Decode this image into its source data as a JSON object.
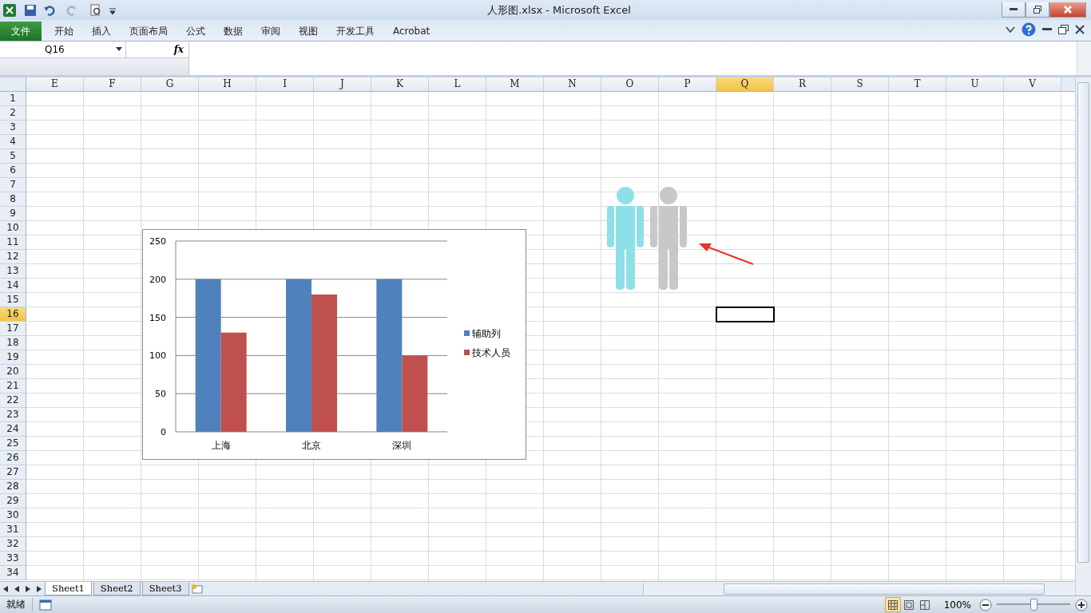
{
  "window": {
    "title": "人形图.xlsx - Microsoft Excel"
  },
  "ribbon_tabs": [
    {
      "label": "文件",
      "kind": "file"
    },
    {
      "label": "开始",
      "kind": "tab"
    },
    {
      "label": "插入",
      "kind": "tab"
    },
    {
      "label": "页面布局",
      "kind": "tab"
    },
    {
      "label": "公式",
      "kind": "tab"
    },
    {
      "label": "数据",
      "kind": "tab"
    },
    {
      "label": "审阅",
      "kind": "tab"
    },
    {
      "label": "视图",
      "kind": "tab"
    },
    {
      "label": "开发工具",
      "kind": "tab"
    },
    {
      "label": "Acrobat",
      "kind": "tab"
    }
  ],
  "formula_bar": {
    "name_box": "Q16",
    "fx": "fx"
  },
  "columns": [
    {
      "label": "E",
      "selected": false
    },
    {
      "label": "F",
      "selected": false
    },
    {
      "label": "G",
      "selected": false
    },
    {
      "label": "H",
      "selected": false
    },
    {
      "label": "I",
      "selected": false
    },
    {
      "label": "J",
      "selected": false
    },
    {
      "label": "K",
      "selected": false
    },
    {
      "label": "L",
      "selected": false
    },
    {
      "label": "M",
      "selected": false
    },
    {
      "label": "N",
      "selected": false
    },
    {
      "label": "O",
      "selected": false
    },
    {
      "label": "P",
      "selected": false
    },
    {
      "label": "Q",
      "selected": true
    },
    {
      "label": "R",
      "selected": false
    },
    {
      "label": "S",
      "selected": false
    },
    {
      "label": "T",
      "selected": false
    },
    {
      "label": "U",
      "selected": false
    },
    {
      "label": "V",
      "selected": false
    }
  ],
  "rows": [
    {
      "label": "1",
      "selected": false
    },
    {
      "label": "2",
      "selected": false
    },
    {
      "label": "3",
      "selected": false
    },
    {
      "label": "4",
      "selected": false
    },
    {
      "label": "5",
      "selected": false
    },
    {
      "label": "6",
      "selected": false
    },
    {
      "label": "7",
      "selected": false
    },
    {
      "label": "8",
      "selected": false
    },
    {
      "label": "9",
      "selected": false
    },
    {
      "label": "10",
      "selected": false
    },
    {
      "label": "11",
      "selected": false
    },
    {
      "label": "12",
      "selected": false
    },
    {
      "label": "13",
      "selected": false
    },
    {
      "label": "14",
      "selected": false
    },
    {
      "label": "15",
      "selected": false
    },
    {
      "label": "16",
      "selected": true
    },
    {
      "label": "17",
      "selected": false
    },
    {
      "label": "18",
      "selected": false
    },
    {
      "label": "19",
      "selected": false
    },
    {
      "label": "20",
      "selected": false
    },
    {
      "label": "21",
      "selected": false
    },
    {
      "label": "22",
      "selected": false
    },
    {
      "label": "23",
      "selected": false
    },
    {
      "label": "24",
      "selected": false
    },
    {
      "label": "25",
      "selected": false
    },
    {
      "label": "26",
      "selected": false
    },
    {
      "label": "27",
      "selected": false
    },
    {
      "label": "28",
      "selected": false
    },
    {
      "label": "29",
      "selected": false
    },
    {
      "label": "30",
      "selected": false
    },
    {
      "label": "31",
      "selected": false
    },
    {
      "label": "32",
      "selected": false
    },
    {
      "label": "33",
      "selected": false
    },
    {
      "label": "34",
      "selected": false
    }
  ],
  "chart": {
    "chart_data": {
      "type": "bar",
      "categories": [
        "上海",
        "北京",
        "深圳"
      ],
      "series": [
        {
          "name": "辅助列",
          "color": "#4f81bd",
          "values": [
            200,
            200,
            200
          ]
        },
        {
          "name": "技术人员",
          "color": "#c0504d",
          "values": [
            130,
            180,
            100
          ]
        }
      ],
      "ylim": [
        0,
        250
      ],
      "yticks": [
        0,
        50,
        100,
        150,
        200,
        250
      ],
      "grid": true,
      "legend": true
    }
  },
  "figures": [
    {
      "color": "#8ee0e8"
    },
    {
      "color": "#c8c8c8"
    }
  ],
  "sheets": [
    {
      "label": "Sheet1",
      "selected": true
    },
    {
      "label": "Sheet2",
      "selected": false
    },
    {
      "label": "Sheet3",
      "selected": false
    }
  ],
  "status_bar": {
    "status": "就绪",
    "zoom": "100%",
    "zoom_level": {
      "level": 0.5
    },
    "views": [
      {
        "kind": "normal",
        "selected": true
      },
      {
        "kind": "layout",
        "selected": false
      },
      {
        "kind": "pagebreak",
        "selected": false
      }
    ]
  }
}
